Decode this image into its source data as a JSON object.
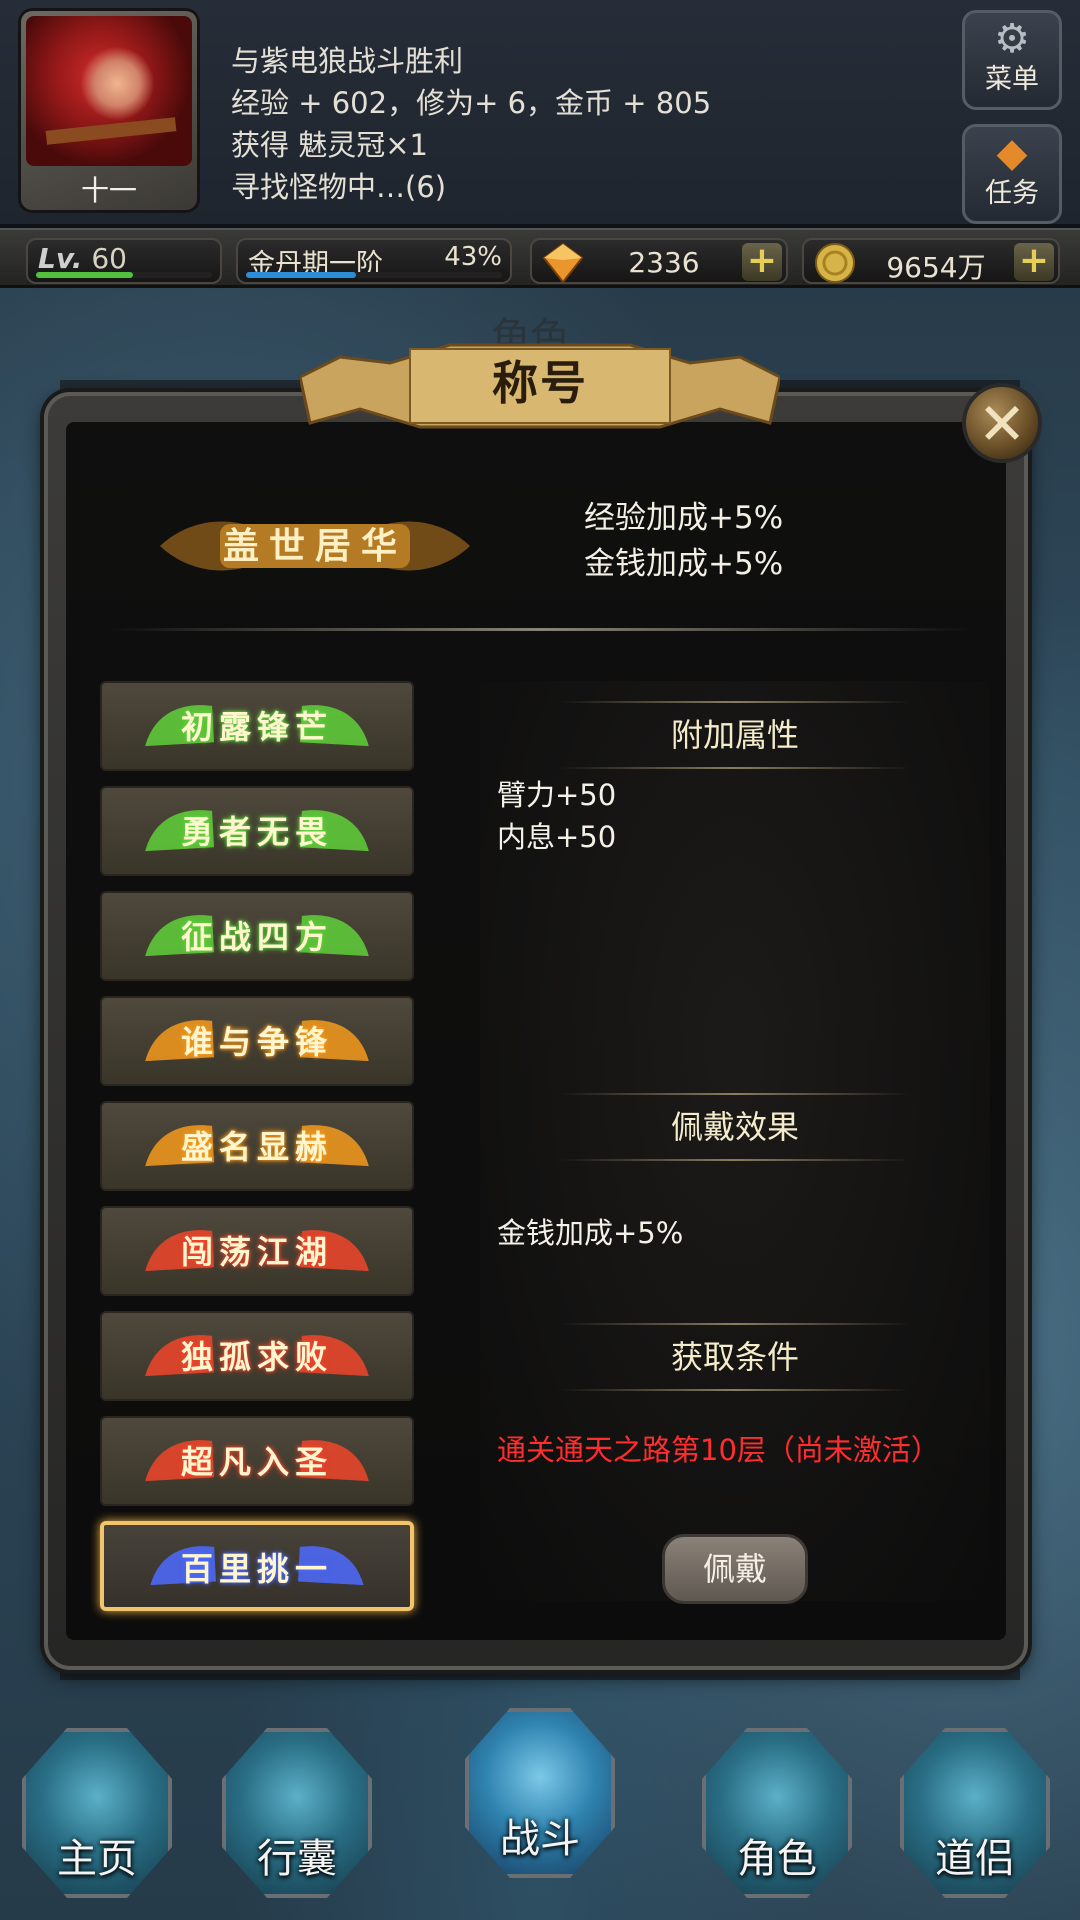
{
  "header": {
    "avatar_name": "十一",
    "log": [
      "与紫电狼战斗胜利",
      "经验 + 602，修为+ 6，金币 + 805",
      "获得 魅灵冠×1",
      "寻找怪物中…(6)"
    ],
    "menu_label": "菜单",
    "quest_label": "任务"
  },
  "stats": {
    "level_prefix": "Lv.",
    "level": "60",
    "level_progress": 0.55,
    "realm": "金丹期一阶",
    "realm_pct": "43%",
    "realm_progress": 0.43,
    "gems": "2336",
    "gold": "9654万"
  },
  "background": {
    "title": "角色"
  },
  "modal": {
    "title": "称号",
    "current_title": "盖世居华",
    "current_bonus": [
      "经验加成+5%",
      "金钱加成+5%"
    ],
    "titles": [
      {
        "name": "初露锋芒",
        "tier": "green"
      },
      {
        "name": "勇者无畏",
        "tier": "green"
      },
      {
        "name": "征战四方",
        "tier": "green"
      },
      {
        "name": "谁与争锋",
        "tier": "orange"
      },
      {
        "name": "盛名显赫",
        "tier": "orange"
      },
      {
        "name": "闯荡江湖",
        "tier": "red"
      },
      {
        "name": "独孤求败",
        "tier": "red"
      },
      {
        "name": "超凡入圣",
        "tier": "red"
      },
      {
        "name": "百里挑一",
        "tier": "blue"
      }
    ],
    "sections": {
      "attr_head": "附加属性",
      "wear_head": "佩戴效果",
      "cond_head": "获取条件"
    },
    "attributes": [
      "臂力+50",
      "内息+50"
    ],
    "wear_effect": "金钱加成+5%",
    "condition": "通关通天之路第10层（尚未激活）",
    "equip_label": "佩戴"
  },
  "nav": [
    {
      "label": "主页",
      "icon": "home-icon"
    },
    {
      "label": "行囊",
      "icon": "bag-icon"
    },
    {
      "label": "战斗",
      "icon": "sword-icon"
    },
    {
      "label": "角色",
      "icon": "character-icon"
    },
    {
      "label": "道侣",
      "icon": "companion-icon"
    }
  ],
  "colors": {
    "green": "#5fd13a",
    "orange": "#f59a1c",
    "red": "#f0452a",
    "blue": "#4d6bff",
    "gold": "#f2c56b",
    "condition": "#ff2e2e"
  }
}
